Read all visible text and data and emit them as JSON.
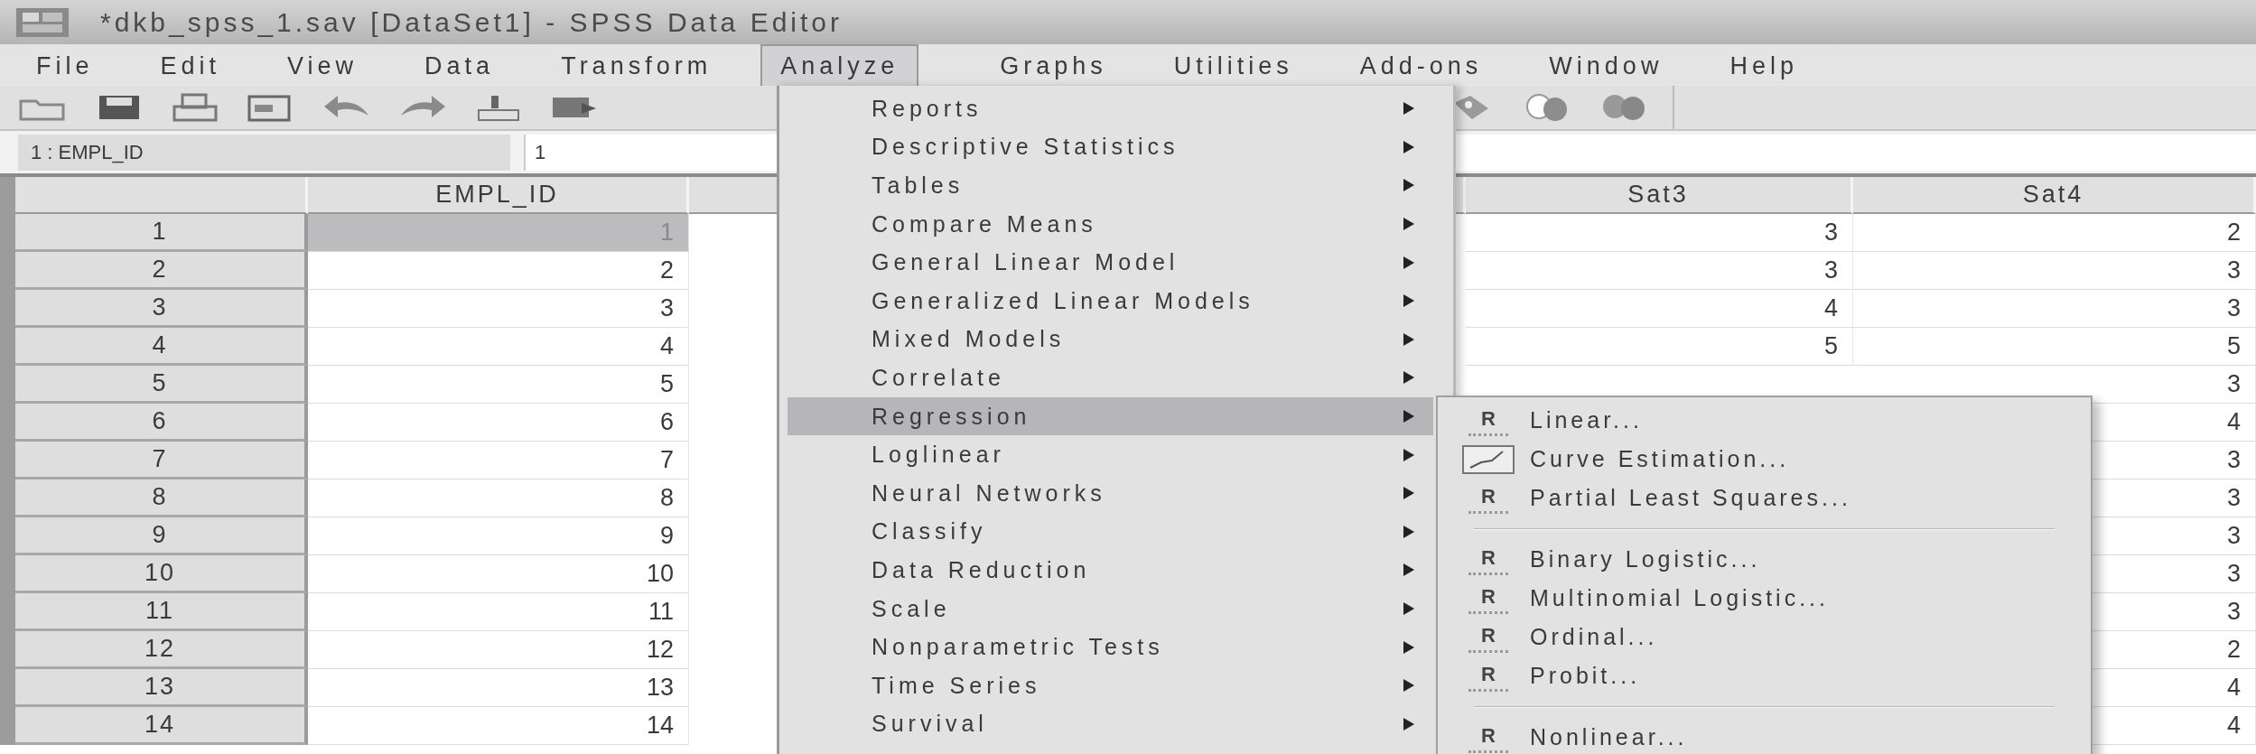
{
  "window": {
    "title": "*dkb_spss_1.sav [DataSet1] - SPSS Data Editor"
  },
  "menu_bar": [
    {
      "label": "File",
      "selected": false
    },
    {
      "label": "Edit",
      "selected": false
    },
    {
      "label": "View",
      "selected": false
    },
    {
      "label": "Data",
      "selected": false
    },
    {
      "label": "Transform",
      "selected": false
    },
    {
      "label": "Analyze",
      "selected": true
    },
    {
      "label": "Graphs",
      "selected": false
    },
    {
      "label": "Utilities",
      "selected": false
    },
    {
      "label": "Add-ons",
      "selected": false
    },
    {
      "label": "Window",
      "selected": false
    },
    {
      "label": "Help",
      "selected": false
    }
  ],
  "cell_bar": {
    "reference": "1 : EMPL_ID",
    "value": "1"
  },
  "table": {
    "columns": [
      {
        "header": "EMPL_ID",
        "kind": "shown"
      },
      {
        "kind": "hidden"
      },
      {
        "kind": "hidden"
      },
      {
        "header": "Sat3",
        "kind": "shown"
      },
      {
        "header": "Sat4",
        "kind": "shown"
      }
    ],
    "rows": [
      {
        "label": "1",
        "cells": [
          "1",
          null,
          null,
          "3",
          "2"
        ],
        "selected": true
      },
      {
        "label": "2",
        "cells": [
          "2",
          null,
          null,
          "3",
          "3"
        ],
        "selected": false
      },
      {
        "label": "3",
        "cells": [
          "3",
          null,
          null,
          "4",
          "3"
        ],
        "selected": false
      },
      {
        "label": "4",
        "cells": [
          "4",
          null,
          null,
          "5",
          "5"
        ],
        "selected": false
      },
      {
        "label": "5",
        "cells": [
          "5",
          null,
          null,
          null,
          "3"
        ],
        "selected": false
      },
      {
        "label": "6",
        "cells": [
          "6",
          null,
          null,
          null,
          "4"
        ],
        "selected": false
      },
      {
        "label": "7",
        "cells": [
          "7",
          null,
          null,
          null,
          "3"
        ],
        "selected": false
      },
      {
        "label": "8",
        "cells": [
          "8",
          null,
          null,
          null,
          "3"
        ],
        "selected": false
      },
      {
        "label": "9",
        "cells": [
          "9",
          null,
          null,
          null,
          "3"
        ],
        "selected": false
      },
      {
        "label": "10",
        "cells": [
          "10",
          null,
          null,
          null,
          "3"
        ],
        "selected": false
      },
      {
        "label": "11",
        "cells": [
          "11",
          null,
          null,
          null,
          "3"
        ],
        "selected": false
      },
      {
        "label": "12",
        "cells": [
          "12",
          null,
          null,
          null,
          "2"
        ],
        "selected": false
      },
      {
        "label": "13",
        "cells": [
          "13",
          null,
          null,
          null,
          "4"
        ],
        "selected": false
      },
      {
        "label": "14",
        "cells": [
          "14",
          null,
          null,
          null,
          "4"
        ],
        "selected": false
      }
    ]
  },
  "analyze_menu": [
    {
      "label": "Reports",
      "submenu": true,
      "selected": false
    },
    {
      "label": "Descriptive Statistics",
      "submenu": true,
      "selected": false
    },
    {
      "label": "Tables",
      "submenu": true,
      "selected": false
    },
    {
      "label": "Compare Means",
      "submenu": true,
      "selected": false
    },
    {
      "label": "General Linear Model",
      "submenu": true,
      "selected": false
    },
    {
      "label": "Generalized Linear Models",
      "submenu": true,
      "selected": false
    },
    {
      "label": "Mixed Models",
      "submenu": true,
      "selected": false
    },
    {
      "label": "Correlate",
      "submenu": true,
      "selected": false
    },
    {
      "label": "Regression",
      "submenu": true,
      "selected": true
    },
    {
      "label": "Loglinear",
      "submenu": true,
      "selected": false
    },
    {
      "label": "Neural Networks",
      "submenu": true,
      "selected": false
    },
    {
      "label": "Classify",
      "submenu": true,
      "selected": false
    },
    {
      "label": "Data Reduction",
      "submenu": true,
      "selected": false
    },
    {
      "label": "Scale",
      "submenu": true,
      "selected": false
    },
    {
      "label": "Nonparametric Tests",
      "submenu": true,
      "selected": false
    },
    {
      "label": "Time Series",
      "submenu": true,
      "selected": false
    },
    {
      "label": "Survival",
      "submenu": true,
      "selected": false
    }
  ],
  "regression_menu": [
    {
      "kind": "r",
      "icon_text": "R",
      "label": "Linear..."
    },
    {
      "kind": "curve",
      "label": "Curve Estimation..."
    },
    {
      "kind": "r",
      "icon_text": "R",
      "label": "Partial Least Squares..."
    },
    {
      "kind": "separator"
    },
    {
      "kind": "r",
      "icon_text": "R",
      "label": "Binary Logistic..."
    },
    {
      "kind": "r",
      "icon_text": "R",
      "label": "Multinomial Logistic..."
    },
    {
      "kind": "r",
      "icon_text": "R",
      "label": "Ordinal..."
    },
    {
      "kind": "r",
      "icon_text": "R",
      "label": "Probit..."
    },
    {
      "kind": "separator"
    },
    {
      "kind": "r",
      "icon_text": "R",
      "label": "Nonlinear..."
    }
  ]
}
